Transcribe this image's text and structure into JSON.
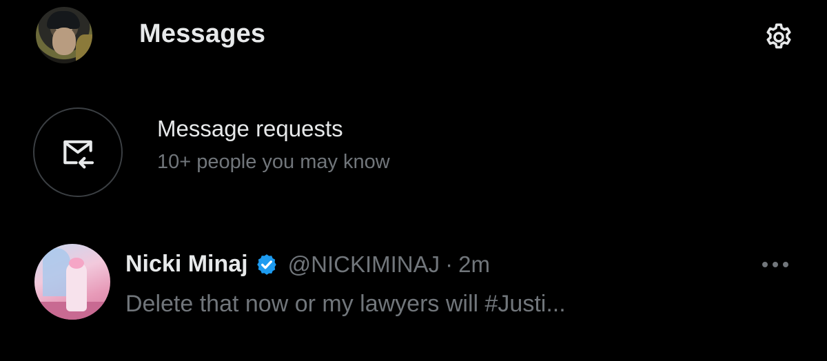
{
  "header": {
    "title": "Messages",
    "avatar_icon": "user-avatar",
    "settings_icon": "gear-icon"
  },
  "requests": {
    "icon": "envelope-arrow-icon",
    "title": "Message requests",
    "subtitle": "10+ people you may know"
  },
  "conversations": [
    {
      "name": "Nicki Minaj",
      "verified": true,
      "handle": "@NICKIMINAJ",
      "separator": "·",
      "time": "2m",
      "preview": "Delete that now or my lawyers will #Justi...",
      "more_icon": "more-horizontal-icon"
    }
  ],
  "colors": {
    "background": "#000000",
    "primary_text": "#e7e9ea",
    "secondary_text": "#71767b",
    "verified_blue": "#1d9bf0",
    "border": "#3b3f43"
  }
}
